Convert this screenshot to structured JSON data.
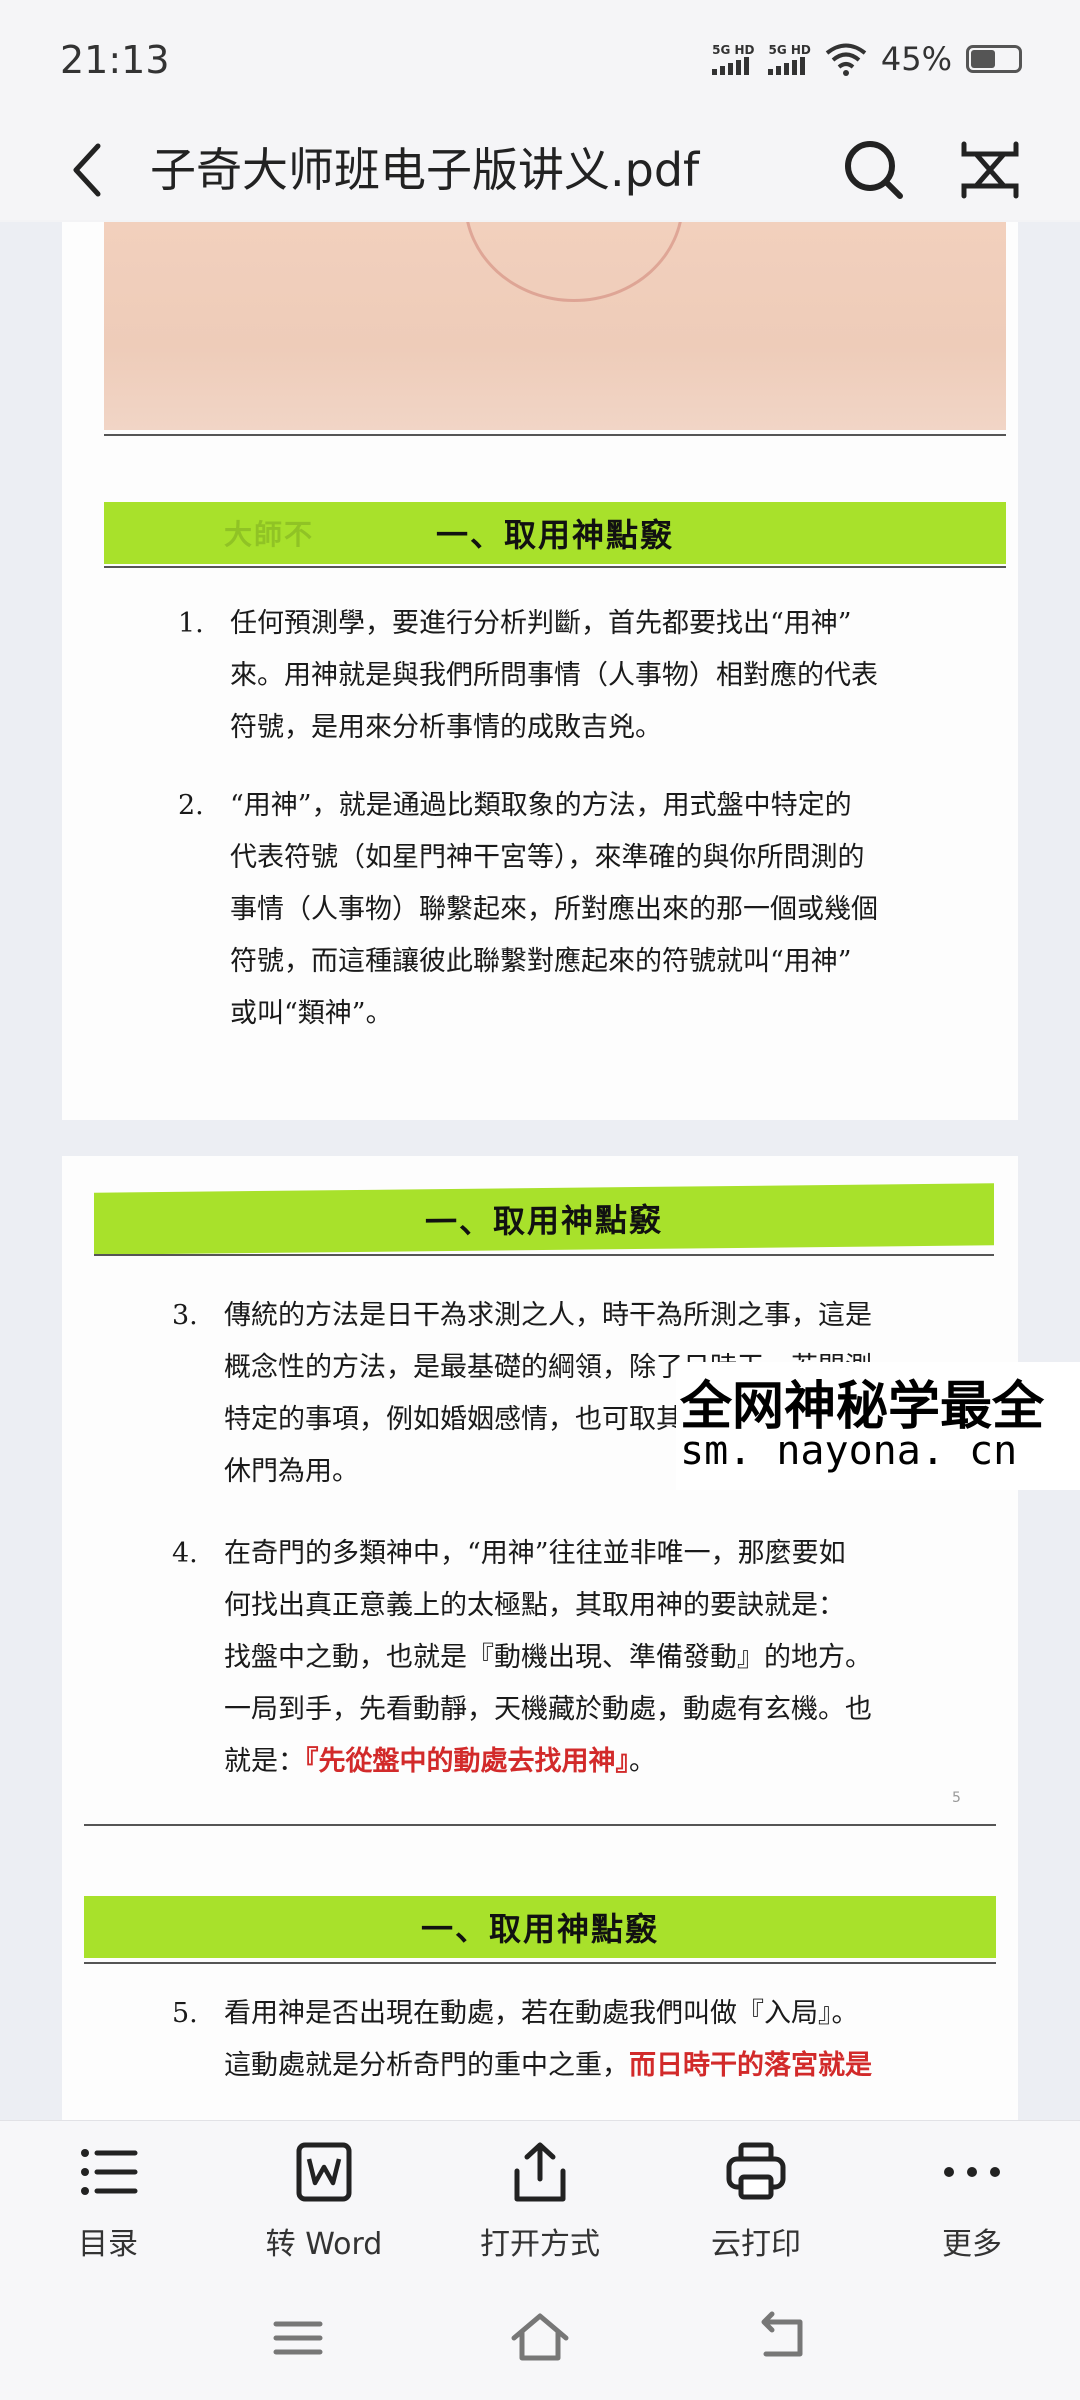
{
  "status": {
    "time": "21:13",
    "signal1": "5G HD",
    "signal2": "5G HD",
    "battery": "45%"
  },
  "header": {
    "title": "子奇大师班电子版讲义.pdf"
  },
  "document": {
    "banner_title": "一、取用神點竅",
    "ghost_text": "大師不",
    "items": [
      {
        "num": "1.",
        "lines": [
          "任何預測學，要進行分析判斷，首先都要找出“用神”",
          "來。用神就是與我們所問事情（人事物）相對應的代表",
          "符號，是用來分析事情的成敗吉兇。"
        ]
      },
      {
        "num": "2.",
        "lines": [
          "“用神”，就是通過比類取象的方法，用式盤中特定的",
          "代表符號（如星門神干宮等），來準確的與你所問測的",
          "事情（人事物）聯繫起來，所對應出來的那一個或幾個",
          "符號，而這種讓彼此聯繫對應起來的符號就叫“用神”",
          "或叫“類神”。"
        ]
      },
      {
        "num": "3.",
        "lines": [
          "傳統的方法是日干為求測之人，時干為所測之事，這是",
          "概念性的方法，是最基礎的綱領，除了日時干，若問測",
          "特定的事項，例如婚姻感情，也可取其專有用神：六合、",
          "休門為用。"
        ]
      },
      {
        "num": "4.",
        "lines": [
          "在奇門的多類神中，“用神”往往並非唯一，那麼要如",
          "何找出真正意義上的太極點，其取用神的要訣就是：",
          "找盤中之動，也就是『動機出現、準備發動』的地方。",
          "一局到手，先看動靜，天機藏於動處，動處有玄機。也"
        ]
      },
      {
        "num": "5.",
        "lines": [
          "看用神是否出現在動處，若在動處我們叫做『入局』。"
        ]
      }
    ],
    "item4_last_prefix": "就是：",
    "item4_last_red": "『先從盤中的動處去找用神』",
    "item4_last_suffix": "。",
    "item5_line2_black": "這動處就是分析奇門的重中之重，",
    "item5_line2_red": "而日時干的落宮就是",
    "page_number": "5"
  },
  "watermark": {
    "line1": "全网神秘学最全",
    "line2": "sm. nayona. cn"
  },
  "toolbar": {
    "toc": "目录",
    "to_word": "转 Word",
    "open_with": "打开方式",
    "cloud_print": "云打印",
    "more": "更多"
  },
  "colors": {
    "banner": "#a8e12b",
    "highlight_red": "#d22a2a"
  }
}
